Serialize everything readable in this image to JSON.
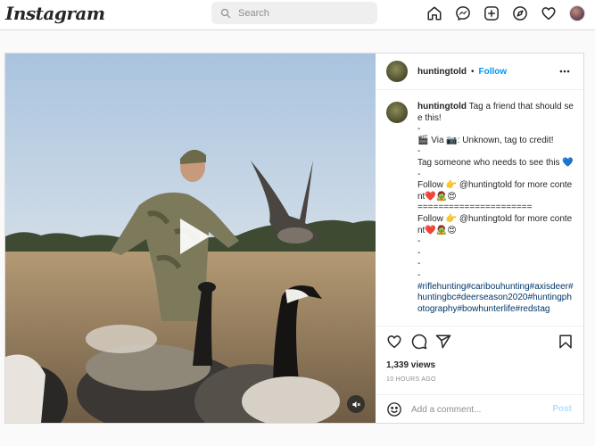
{
  "nav": {
    "logo": "Instagram",
    "search_placeholder": "Search",
    "icons": [
      "home-icon",
      "messenger-icon",
      "new-post-icon",
      "explore-icon",
      "activity-heart-icon",
      "profile-avatar"
    ]
  },
  "post": {
    "username": "huntingtold",
    "dot": "•",
    "follow_label": "Follow",
    "caption": {
      "username": "huntingtold",
      "lines": [
        "Tag a friend that should see this!",
        "-",
        "🎬 Via 📷: Unknown, tag to credit!",
        "-",
        "Tag someone who needs to see this 💙",
        "-",
        "Follow 👉 @huntingtold for more content❤️🧟😍",
        "======================",
        "Follow 👉 @huntingtold for more content❤️🧟😍",
        "-",
        "-",
        "-",
        "-",
        "#riflehunting#caribouhunting#axisdeer#huntingbc#deerseason2020#huntingphotography#bowhunterlife#redstag"
      ],
      "mention": "@huntingtold"
    },
    "views": "1,339 views",
    "time_ago": "10 HOURS AGO",
    "comment_placeholder": "Add a comment...",
    "post_label": "Post"
  },
  "colors": {
    "accent": "#0095f6",
    "post_disabled": "#b2dffc",
    "border": "#dbdbdb",
    "text": "#262626",
    "muted": "#8e8e8e"
  }
}
